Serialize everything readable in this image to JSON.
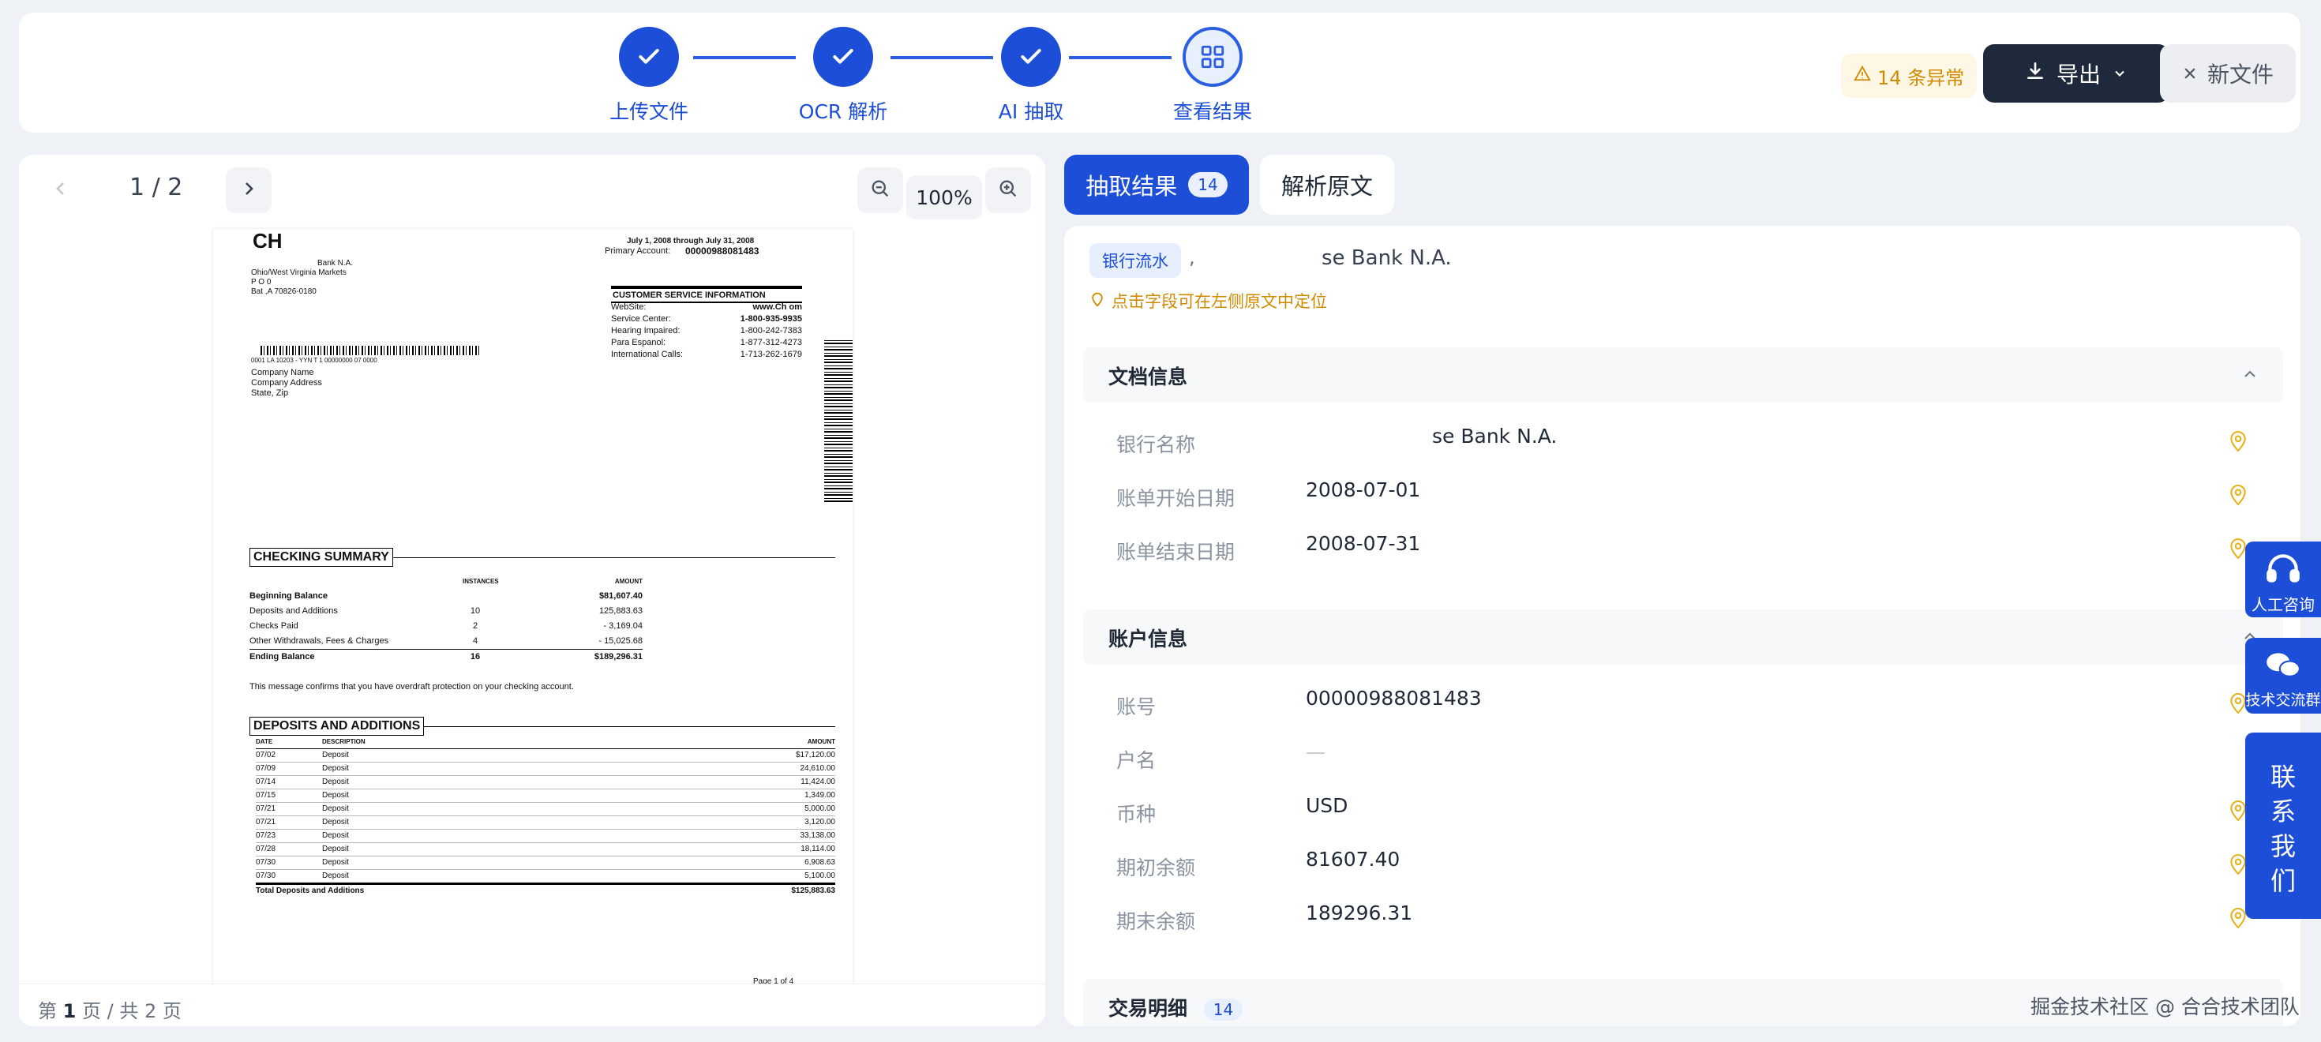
{
  "steps": [
    {
      "label": "上传文件",
      "icon": "check-icon"
    },
    {
      "label": "OCR 解析",
      "icon": "check-icon"
    },
    {
      "label": "AI 抽取",
      "icon": "check-icon"
    },
    {
      "label": "查看结果",
      "icon": "grid-icon"
    }
  ],
  "header": {
    "alert_text": "14 条异常",
    "export_label": "导出",
    "new_label": "新文件"
  },
  "viewer": {
    "page_indicator": "1 / 2",
    "zoom": "100%",
    "footer_prefix": "第",
    "footer_page": "1",
    "footer_mid": "页 / 共",
    "footer_total": "2",
    "footer_suffix": "页"
  },
  "doc": {
    "logo": "CH",
    "bank_line1": "Bank N.A.",
    "bank_line2": "Ohio/West Virginia Markets",
    "bank_line3": "P O          0",
    "bank_line4": "Bat          ,A 70826-0180",
    "period": "July 1, 2008 through July 31, 2008",
    "primary_label": "Primary Account:",
    "primary_account": "00000988081483",
    "csi_title": "CUSTOMER SERVICE INFORMATION",
    "csi_rows": [
      {
        "k": "WebSite:",
        "v": "www.Ch       om"
      },
      {
        "k": "Service Center:",
        "v": "1-800-935-9935"
      },
      {
        "k": "Hearing Impaired:",
        "v": "1-800-242-7383"
      },
      {
        "k": "Para Espanol:",
        "v": "1-877-312-4273"
      },
      {
        "k": "International Calls:",
        "v": "1-713-262-1679"
      }
    ],
    "addr_code": "0001          LA 10203 - YYN T 1 00000000 07 0000",
    "addr1": "Company Name",
    "addr2": "Company Address",
    "addr3": "State, Zip",
    "summary_title": "CHECKING SUMMARY",
    "col_instances": "INSTANCES",
    "col_amount": "AMOUNT",
    "summary_rows": [
      {
        "label": "Beginning Balance",
        "inst": "",
        "amt": "$81,607.40",
        "bold": true
      },
      {
        "label": "Deposits and Additions",
        "inst": "10",
        "amt": "125,883.63",
        "bold": false
      },
      {
        "label": "Checks Paid",
        "inst": "2",
        "amt": "- 3,169.04",
        "bold": false
      },
      {
        "label": "Other Withdrawals, Fees & Charges",
        "inst": "4",
        "amt": "- 15,025.68",
        "bold": false
      },
      {
        "label": "Ending Balance",
        "inst": "16",
        "amt": "$189,296.31",
        "bold": true
      }
    ],
    "overdraft_msg": "This message confirms that you have overdraft protection on your checking account.",
    "deposits_title": "DEPOSITS AND ADDITIONS",
    "dep_col_date": "DATE",
    "dep_col_desc": "DESCRIPTION",
    "dep_col_amt": "AMOUNT",
    "deposits": [
      {
        "date": "07/02",
        "desc": "Deposit",
        "amt": "$17,120.00"
      },
      {
        "date": "07/09",
        "desc": "Deposit",
        "amt": "24,610.00"
      },
      {
        "date": "07/14",
        "desc": "Deposit",
        "amt": "11,424.00"
      },
      {
        "date": "07/15",
        "desc": "Deposit",
        "amt": "1,349.00"
      },
      {
        "date": "07/21",
        "desc": "Deposit",
        "amt": "5,000.00"
      },
      {
        "date": "07/21",
        "desc": "Deposit",
        "amt": "3,120.00"
      },
      {
        "date": "07/23",
        "desc": "Deposit",
        "amt": "33,138.00"
      },
      {
        "date": "07/28",
        "desc": "Deposit",
        "amt": "18,114.00"
      },
      {
        "date": "07/30",
        "desc": "Deposit",
        "amt": "6,908.63"
      },
      {
        "date": "07/30",
        "desc": "Deposit",
        "amt": "5,100.00"
      }
    ],
    "dep_total_label": "Total Deposits and Additions",
    "dep_total_amt": "$125,883.63",
    "page_of": "Page 1 of 4"
  },
  "results": {
    "tab_active": "抽取结果",
    "tab_badge": "14",
    "tab_raw": "解析原文",
    "doc_type": "银行流水",
    "bank_name_top": "se Bank N.A.",
    "hint": "点击字段可在左侧原文中定位",
    "sections": {
      "doc_info": "文档信息",
      "account_info": "账户信息",
      "transactions": "交易明细",
      "transactions_count": "14"
    },
    "doc_fields": [
      {
        "label": "银行名称",
        "value": "se Bank N.A."
      },
      {
        "label": "账单开始日期",
        "value": "2008-07-01"
      },
      {
        "label": "账单结束日期",
        "value": "2008-07-31"
      }
    ],
    "account_fields": [
      {
        "label": "账号",
        "value": "00000988081483"
      },
      {
        "label": "户名",
        "value": "—"
      },
      {
        "label": "币种",
        "value": "USD"
      },
      {
        "label": "期初余额",
        "value": "81607.40"
      },
      {
        "label": "期末余额",
        "value": "189296.31"
      }
    ]
  },
  "side": {
    "consult": "人工咨询",
    "group": "技术交流群",
    "contact": [
      "联",
      "系",
      "我",
      "们"
    ]
  },
  "watermark": "掘金技术社区 @ 合合技术团队",
  "colors": {
    "primary": "#1d4ed8",
    "dark": "#1e2a3b",
    "warn": "#d08a00",
    "pin": "#e6b422"
  }
}
